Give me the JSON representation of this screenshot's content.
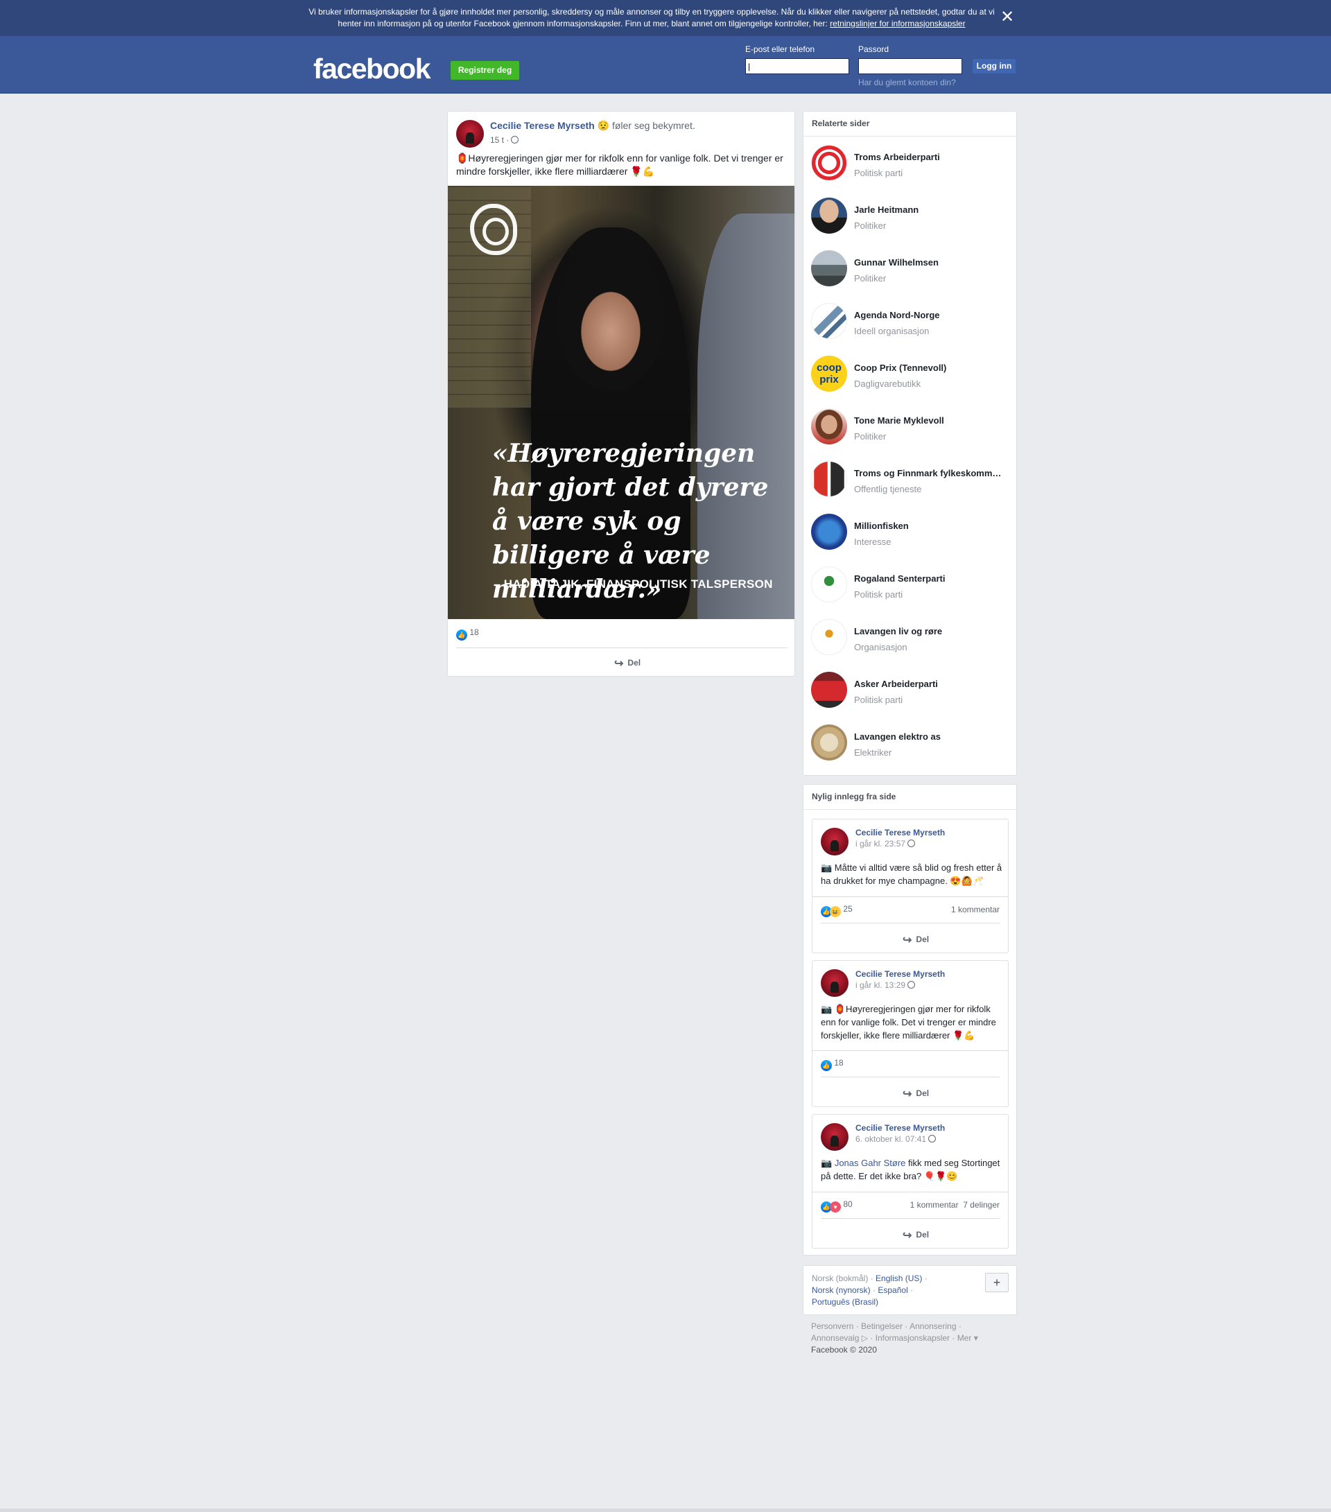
{
  "cookie_banner": {
    "text": "Vi bruker informasjonskapsler for å gjøre innholdet mer personlig, skreddersy og måle annonser og tilby en tryggere opplevelse. Når du klikker eller navigerer på nettstedet, godtar du at vi henter inn informasjon på og utenfor Facebook gjennom informasjonskapsler. Finn ut mer, blant annet om tilgjengelige kontroller, her: ",
    "link_text": "retningslinjer for informasjonskapsler",
    "close_icon": "close-icon"
  },
  "header": {
    "logo": "facebook",
    "register_label": "Registrer deg",
    "email_label": "E-post eller telefon",
    "email_value": "|",
    "password_label": "Passord",
    "password_value": "",
    "login_label": "Logg inn",
    "forgot_label": "Har du glemt kontoen din?"
  },
  "main_post": {
    "author": "Cecilie Terese Myrseth",
    "feeling": "føler seg bekymret.",
    "time": "15 t ·",
    "text": "🏮Høyreregjeringen gjør mer for rikfolk enn for vanlige folk. Det vi trenger er mindre forskjeller, ikke flere milliardærer 🌹💪",
    "image_quote": "«Høyreregjeringen har gjort det dyrere å være syk og billigere å være milliardær.»",
    "image_attribution": "– HADIA TAJIK, FINANSPOLITISK TALSPERSON",
    "likes": "18",
    "share_label": "Del"
  },
  "related": {
    "title": "Relaterte sider",
    "items": [
      {
        "name": "Troms Arbeiderparti",
        "category": "Politisk parti"
      },
      {
        "name": "Jarle Heitmann",
        "category": "Politiker"
      },
      {
        "name": "Gunnar Wilhelmsen",
        "category": "Politiker"
      },
      {
        "name": "Agenda Nord-Norge",
        "category": "Ideell organisasjon"
      },
      {
        "name": "Coop Prix (Tennevoll)",
        "category": "Dagligvarebutikk"
      },
      {
        "name": "Tone Marie Myklevoll",
        "category": "Politiker"
      },
      {
        "name": "Troms og Finnmark fylkeskommune",
        "category": "Offentlig tjeneste"
      },
      {
        "name": "Millionfisken",
        "category": "Interesse"
      },
      {
        "name": "Rogaland Senterparti",
        "category": "Politisk parti"
      },
      {
        "name": "Lavangen liv og røre",
        "category": "Organisasjon"
      },
      {
        "name": "Asker Arbeiderparti",
        "category": "Politisk parti"
      },
      {
        "name": "Lavangen elektro as",
        "category": "Elektriker"
      }
    ]
  },
  "recent": {
    "title": "Nylig innlegg fra side",
    "posts": [
      {
        "author": "Cecilie Terese Myrseth",
        "time": "i går kl. 23:57",
        "text": "📷 Måtte vi alltid være så blid og fresh etter å ha drukket for mye champagne. 😍🙆🥂",
        "reactions": "25",
        "comments": "1 kommentar",
        "shares": "",
        "share_label": "Del"
      },
      {
        "author": "Cecilie Terese Myrseth",
        "time": "i går kl. 13:29",
        "text": "📷 🏮Høyreregjeringen gjør mer for rikfolk enn for vanlige folk. Det vi trenger er mindre forskjeller, ikke flere milliardærer 🌹💪",
        "reactions": "18",
        "comments": "",
        "shares": "",
        "share_label": "Del"
      },
      {
        "author": "Cecilie Terese Myrseth",
        "time": "6. oktober kl. 07:41",
        "text_link": "Jonas Gahr Støre",
        "text": " fikk med seg Stortinget på dette. Er det ikke bra? 🎈🌹😊",
        "reactions": "80",
        "comments": "1 kommentar",
        "shares": "7 delinger",
        "share_label": "Del"
      }
    ]
  },
  "languages": {
    "current": "Norsk (bokmål)",
    "others": [
      "English (US)",
      "Norsk (nynorsk)",
      "Español",
      "Português (Brasil)"
    ],
    "plus_label": "+"
  },
  "footer": {
    "links": [
      "Personvern",
      "Betingelser",
      "Annonsering",
      "Annonsevalg",
      "Informasjonskapsler",
      "Mer"
    ],
    "copyright": "Facebook © 2020"
  },
  "colors": {
    "brand": "#3b5998",
    "cookie_bg": "#2f477a",
    "register": "#42b72a",
    "link": "#385898",
    "page_bg": "#e9ebee"
  }
}
